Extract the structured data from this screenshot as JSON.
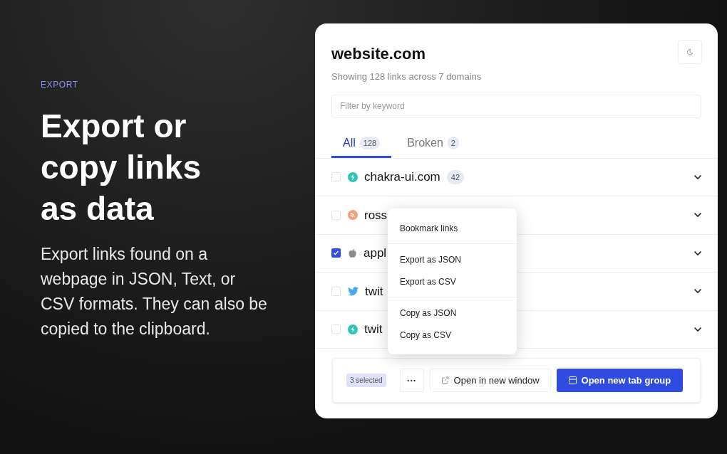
{
  "section_label": "EXPORT",
  "headline": [
    "Export or",
    "copy links",
    "as data"
  ],
  "description": "Export links found on a webpage in JSON, Text, or CSV formats. They can also be copied to the clipboard.",
  "panel": {
    "title": "website.com",
    "subtitle": "Showing 128 links across 7 domains",
    "filter": {
      "placeholder": "Filter by keyword"
    },
    "tabs": [
      {
        "label": "All",
        "count": "128",
        "selected": true
      },
      {
        "label": "Broken",
        "count": "2",
        "selected": false
      }
    ],
    "domains": [
      {
        "name": "chakra-ui.com",
        "count": "42",
        "checked": false,
        "kind": "bolt",
        "color": "#2ec4b6"
      },
      {
        "name": "ross",
        "checked": false,
        "kind": "feed",
        "color": "#f0a07a"
      },
      {
        "name": "appl",
        "checked": true,
        "kind": "apple",
        "color": "#8a8a8a"
      },
      {
        "name": "twit",
        "checked": false,
        "kind": "bird",
        "color": "#4aa8e8"
      },
      {
        "name": "twit",
        "checked": false,
        "kind": "bolt",
        "color": "#2ec4b6"
      }
    ],
    "menu": [
      [
        {
          "label": "Bookmark links"
        }
      ],
      [
        {
          "label": "Export as JSON"
        },
        {
          "label": "Export as CSV"
        }
      ],
      [
        {
          "label": "Copy as JSON"
        },
        {
          "label": "Copy as CSV"
        }
      ]
    ],
    "footer": {
      "selected": "3 selected",
      "more": "···",
      "secondary": "Open in new window",
      "primary": "Open new tab group"
    }
  }
}
